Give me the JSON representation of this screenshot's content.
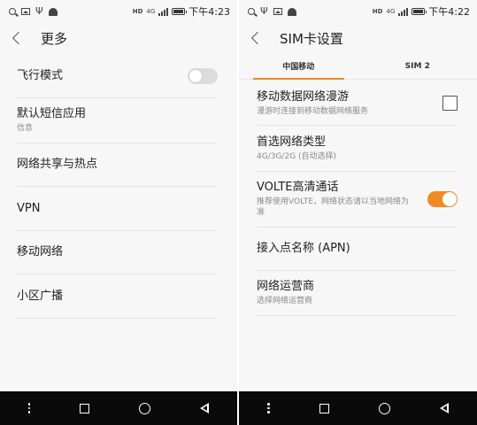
{
  "left": {
    "status": {
      "hd": "HD",
      "network": "4G",
      "time": "下午4:23"
    },
    "title": "更多",
    "items": [
      {
        "title": "飞行模式",
        "subtitle": "",
        "control": "toggle-off"
      },
      {
        "title": "默认短信应用",
        "subtitle": "信息"
      },
      {
        "title": "网络共享与热点",
        "subtitle": ""
      },
      {
        "title": "VPN",
        "subtitle": ""
      },
      {
        "title": "移动网络",
        "subtitle": ""
      },
      {
        "title": "小区广播",
        "subtitle": ""
      }
    ]
  },
  "right": {
    "status": {
      "hd": "HD",
      "network": "4G",
      "time": "下午4:22"
    },
    "title": "SIM卡设置",
    "tabs": [
      {
        "label": "中国移动",
        "active": true
      },
      {
        "label": "SIM 2",
        "active": false
      }
    ],
    "items": [
      {
        "title": "移动数据网络漫游",
        "subtitle": "漫游时连接到移动数据网络服务",
        "control": "checkbox"
      },
      {
        "title": "首选网络类型",
        "subtitle": "4G/3G/2G (自动选择)"
      },
      {
        "title": "VOLTE高清通话",
        "subtitle": "推荐使用VOLTE，网络状态请以当地网络为准",
        "control": "toggle-on"
      },
      {
        "title": "接入点名称 (APN)",
        "subtitle": ""
      },
      {
        "title": "网络运营商",
        "subtitle": "选择网络运营商"
      }
    ]
  },
  "colors": {
    "accent": "#f08a24",
    "navbar": "#0a0a0a",
    "background": "#f7f7f7"
  }
}
